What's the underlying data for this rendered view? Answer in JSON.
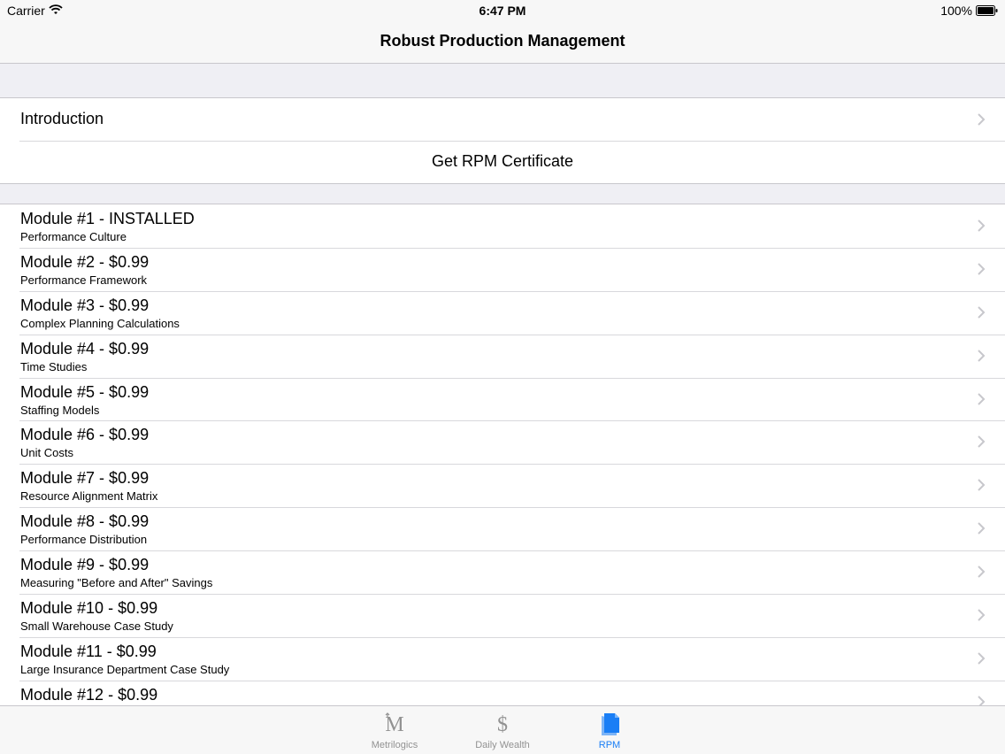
{
  "status_bar": {
    "carrier": "Carrier",
    "time": "6:47 PM",
    "battery": "100%"
  },
  "nav": {
    "title": "Robust Production Management"
  },
  "top_rows": {
    "introduction": "Introduction",
    "certificate": "Get RPM Certificate"
  },
  "modules": [
    {
      "title": "Module #1 - INSTALLED",
      "subtitle": "Performance Culture"
    },
    {
      "title": "Module #2 - $0.99",
      "subtitle": "Performance Framework"
    },
    {
      "title": "Module #3 - $0.99",
      "subtitle": "Complex Planning Calculations"
    },
    {
      "title": "Module #4 - $0.99",
      "subtitle": "Time Studies"
    },
    {
      "title": "Module #5 - $0.99",
      "subtitle": "Staffing Models"
    },
    {
      "title": "Module #6 - $0.99",
      "subtitle": "Unit Costs"
    },
    {
      "title": "Module #7 - $0.99",
      "subtitle": "Resource Alignment Matrix"
    },
    {
      "title": "Module #8 - $0.99",
      "subtitle": "Performance Distribution"
    },
    {
      "title": "Module #9 - $0.99",
      "subtitle": "Measuring \"Before and After\" Savings"
    },
    {
      "title": "Module #10 - $0.99",
      "subtitle": "Small Warehouse Case Study"
    },
    {
      "title": "Module #11 - $0.99",
      "subtitle": "Large Insurance Department Case Study"
    },
    {
      "title": "Module #12 - $0.99",
      "subtitle": ""
    }
  ],
  "tabs": [
    {
      "label": "Metrilogics",
      "icon": "metrilogics-m-icon",
      "active": false
    },
    {
      "label": "Daily Wealth",
      "icon": "dollar-icon",
      "active": false
    },
    {
      "label": "RPM",
      "icon": "document-icon",
      "active": true
    }
  ],
  "colors": {
    "accent": "#1a7ef5",
    "inactive_tab": "#929292",
    "background": "#efeff4"
  }
}
